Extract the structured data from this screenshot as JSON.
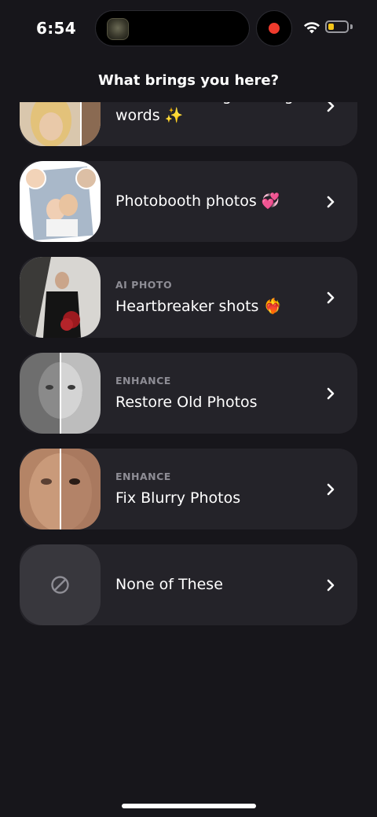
{
  "status_bar": {
    "time": "6:54",
    "battery_color": "#f5c518",
    "record_color": "#ef3b2d"
  },
  "header": {
    "title": "What brings you here?"
  },
  "options": [
    {
      "tag": "",
      "title": "Transform images using words ✨"
    },
    {
      "tag": "",
      "title": "Photobooth photos 💞"
    },
    {
      "tag": "AI PHOTO",
      "title": "Heartbreaker shots ❤️‍🔥"
    },
    {
      "tag": "ENHANCE",
      "title": "Restore Old Photos"
    },
    {
      "tag": "ENHANCE",
      "title": "Fix Blurry Photos"
    },
    {
      "tag": "",
      "title": "None of These"
    }
  ],
  "icons": {
    "chevron": "chevron-right-icon",
    "none": "prohibited-icon"
  }
}
